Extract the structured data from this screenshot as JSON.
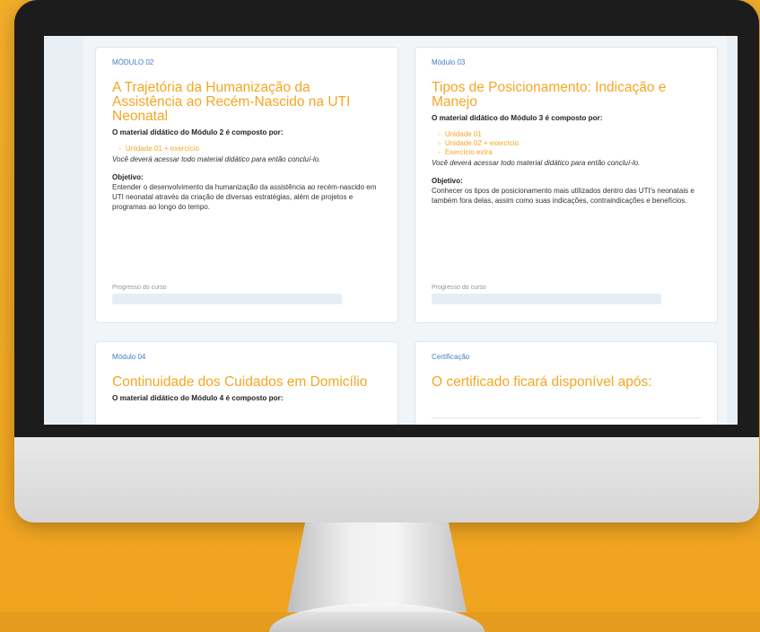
{
  "cards": [
    {
      "label": "MÓDULO 02",
      "title": "A Trajetória da Humanização da Assistência ao Recém-Nascido na UTI Neonatal",
      "intro": "O material didático do Módulo 2 é composto por:",
      "units": [
        "Unidade 01 + exercício"
      ],
      "note": "Você deverá acessar todo material didático para então concluí-lo.",
      "objective_heading": "Objetivo:",
      "objective_text": "Entender o desenvolvimento da humanização da assistência ao recém-nascido em UTI neonatal através da criação de diversas estratégias, além de projetos e programas ao longo do tempo.",
      "progress_label": "Progresso do curso",
      "progress": 0
    },
    {
      "label": "Módulo 03",
      "title": "Tipos de Posicionamento: Indicação e Manejo",
      "intro": "O material didático do Módulo 3 é composto por:",
      "units": [
        "Unidade 01",
        "Unidade 02 + exercício",
        "Exercício extra"
      ],
      "note": "Você deverá acessar todo material didático para então concluí-lo.",
      "objective_heading": "Objetivo:",
      "objective_text": "Conhecer os tipos de posicionamento mais utilizados dentro das UTI's neonatais e também fora delas, assim como suas indicações, contraindicações e benefícios.",
      "progress_label": "Progresso do curso",
      "progress": 0
    },
    {
      "label": "Módulo 04",
      "title": "Continuidade dos Cuidados em Domicílio",
      "intro": "O material didático do Módulo 4 é composto por:"
    },
    {
      "label": "Certificação",
      "title": "O certificado ficará disponível após:"
    }
  ],
  "colors": {
    "accent": "#f5a623",
    "link": "#3f7dc9",
    "background": "#f2ad2a"
  }
}
